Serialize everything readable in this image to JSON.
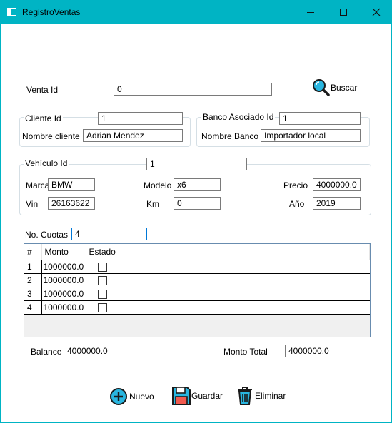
{
  "window": {
    "title": "RegistroVentas"
  },
  "venta": {
    "label": "Venta Id",
    "value": "0"
  },
  "buscar": {
    "label": "Buscar"
  },
  "cliente": {
    "group_label": "Cliente Id",
    "id_value": "1",
    "nombre_label": "Nombre cliente",
    "nombre_value": "Adrian Mendez"
  },
  "banco": {
    "group_label": "Banco Asociado Id",
    "id_value": "1",
    "nombre_label": "Nombre Banco",
    "nombre_value": "Importador local"
  },
  "vehiculo": {
    "group_label": "Vehículo Id",
    "id_value": "1",
    "marca_label": "Marca",
    "marca_value": "BMW",
    "modelo_label": "Modelo",
    "modelo_value": "x6",
    "precio_label": "Precio",
    "precio_value": "4000000.0",
    "vin_label": "Vin",
    "vin_value": "26163622",
    "km_label": "Km",
    "km_value": "0",
    "anio_label": "Año",
    "anio_value": "2019"
  },
  "cuotas": {
    "label": "No. Cuotas",
    "value": "4"
  },
  "grid": {
    "headers": [
      "#",
      "Monto",
      "Estado"
    ],
    "rows": [
      {
        "num": "1",
        "monto": "1000000.0"
      },
      {
        "num": "2",
        "monto": "1000000.0"
      },
      {
        "num": "3",
        "monto": "1000000.0"
      },
      {
        "num": "4",
        "monto": "1000000.0"
      }
    ]
  },
  "balance": {
    "label": "Balance",
    "value": "4000000.0"
  },
  "monto_total": {
    "label": "Monto Total",
    "value": "4000000.0"
  },
  "actions": {
    "nuevo": "Nuevo",
    "guardar": "Guardar",
    "eliminar": "Eliminar"
  },
  "colors": {
    "accent": "#00b4c4",
    "icon_stroke": "#1a1a1a",
    "icon_fill": "#29b6e0",
    "save_red": "#f05a4f"
  }
}
